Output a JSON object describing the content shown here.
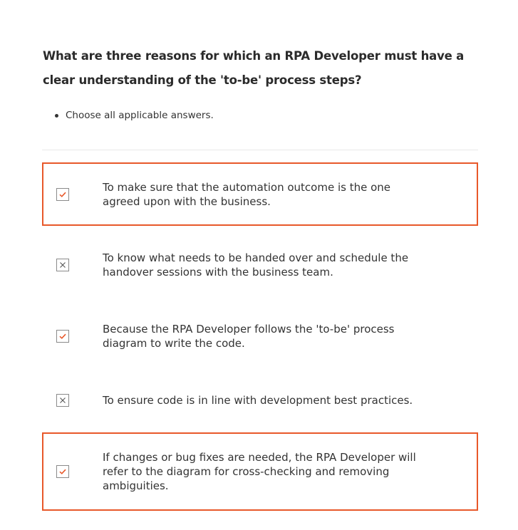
{
  "question": {
    "text": "What are three reasons for which an RPA Developer must have a clear understanding of the 'to-be' process steps?"
  },
  "instructions": [
    "Choose all applicable answers."
  ],
  "options": [
    {
      "text": "To make sure that the automation outcome is the one agreed upon with the business.",
      "mark": "check",
      "icon": "checkmark-icon",
      "highlighted": true
    },
    {
      "text": "To know what needs to be handed over and schedule the handover sessions with the business team.",
      "mark": "cross",
      "icon": "x-icon",
      "highlighted": false
    },
    {
      "text": "Because the RPA Developer follows the 'to-be' process diagram to write the code.",
      "mark": "check",
      "icon": "checkmark-icon",
      "highlighted": false
    },
    {
      "text": "To ensure code is in line with development best practices.",
      "mark": "cross",
      "icon": "x-icon",
      "highlighted": false
    },
    {
      "text": "If changes or bug fixes are needed, the RPA Developer will refer to the diagram for cross-checking and removing ambiguities.",
      "mark": "check",
      "icon": "checkmark-icon",
      "highlighted": true
    }
  ],
  "colors": {
    "highlight_border": "#e8582a",
    "check_mark": "#e8582a",
    "cross_mark": "#555555",
    "text": "#333333"
  }
}
